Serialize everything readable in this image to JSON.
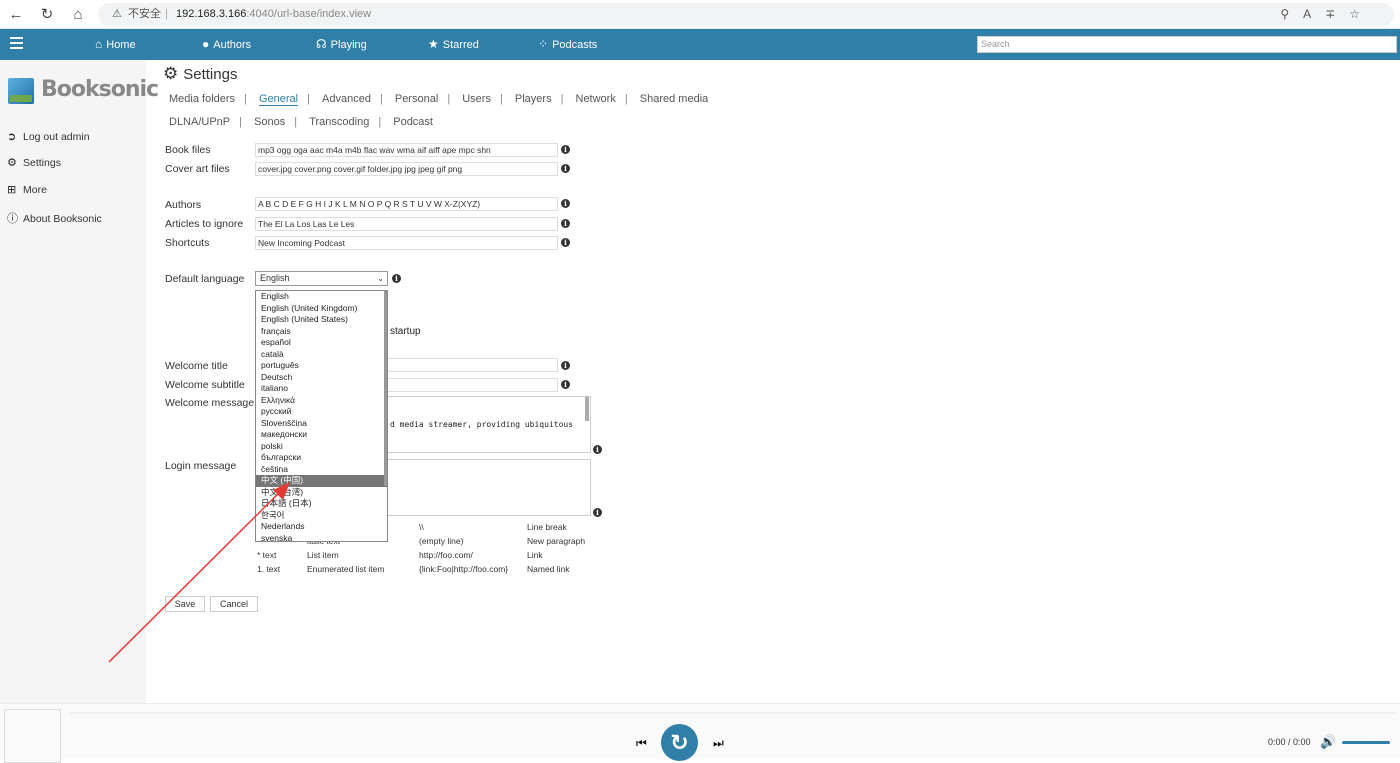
{
  "browser": {
    "security": "不安全",
    "url_host": "192.168.3.166",
    "url_rest": ":4040/url-base/index.view"
  },
  "nav": {
    "items": [
      {
        "label": "Home",
        "icon": "home-icon"
      },
      {
        "label": "Authors",
        "icon": "user-icon"
      },
      {
        "label": "Playing",
        "icon": "headphones-icon"
      },
      {
        "label": "Starred",
        "icon": "star-icon"
      },
      {
        "label": "Podcasts",
        "icon": "rss-icon"
      }
    ],
    "search_placeholder": "Search"
  },
  "sidebar": {
    "logo": "Booksonic",
    "links": [
      {
        "label": "Log out admin",
        "icon": "logout-icon"
      },
      {
        "label": "Settings",
        "icon": "gear-icon"
      },
      {
        "label": "More",
        "icon": "plus-icon"
      },
      {
        "label": "About Booksonic",
        "icon": "info-icon"
      }
    ]
  },
  "page": {
    "title": "Settings",
    "tabs_row1": [
      "Media folders",
      "General",
      "Advanced",
      "Personal",
      "Users",
      "Players",
      "Network",
      "Shared media"
    ],
    "tabs_row2": [
      "DLNA/UPnP",
      "Sonos",
      "Transcoding",
      "Podcast"
    ],
    "active_tab": "General"
  },
  "form": {
    "book_files": {
      "label": "Book files",
      "value": "mp3 ogg oga aac m4a m4b flac wav wma aif aiff ape mpc shn"
    },
    "cover_art_files": {
      "label": "Cover art files",
      "value": "cover.jpg cover.png cover.gif folder.jpg jpg jpeg gif png"
    },
    "authors": {
      "label": "Authors",
      "value": "A B C D E F G H I J K L M N O P Q R S T U V W X-Z(XYZ)"
    },
    "articles": {
      "label": "Articles to ignore",
      "value": "The El La Los Las Le Les"
    },
    "shortcuts": {
      "label": "Shortcuts",
      "value": "New Incoming Podcast"
    },
    "default_language": {
      "label": "Default language",
      "value": "English"
    },
    "startup_text": "startup",
    "welcome_title": {
      "label": "Welcome title"
    },
    "welcome_subtitle": {
      "label": "Welcome subtitle"
    },
    "welcome_message": {
      "label": "Welcome message",
      "partial_text": "d media streamer, providing ubiquitous"
    },
    "login_message": {
      "label": "Login message"
    }
  },
  "language_options": [
    "English",
    "English (United Kingdom)",
    "English (United States)",
    "français",
    "español",
    "català",
    "português",
    "Deutsch",
    "italiano",
    "Ελληνικά",
    "русский",
    "Slovenščina",
    "македонски",
    "polski",
    "български",
    "čeština",
    "中文 (中国)",
    "中文 (台湾)",
    "日本語 (日本)",
    "한국어",
    "Nederlands",
    "svenska"
  ],
  "selected_option_index": 16,
  "markup_help": {
    "row1": {
      "c2": "",
      "c3": "\\\\",
      "c4": "Line break"
    },
    "row2": {
      "c2": "italic text",
      "c3": "(empty line)",
      "c4": "New paragraph"
    },
    "row3": {
      "c1": "* text",
      "c2": "List item",
      "c3": "http://foo.com/",
      "c4": "Link"
    },
    "row4": {
      "c1": "1. text",
      "c2": "Enumerated list item",
      "c3": "{link:Foo|http://foo.com}",
      "c4": "Named link"
    }
  },
  "buttons": {
    "save": "Save",
    "cancel": "Cancel"
  },
  "player": {
    "time": "0:00 / 0:00",
    "volume_level": 1.0
  },
  "colors": {
    "accent": "#2f7fa8",
    "annotation_arrow": "#e53935"
  }
}
